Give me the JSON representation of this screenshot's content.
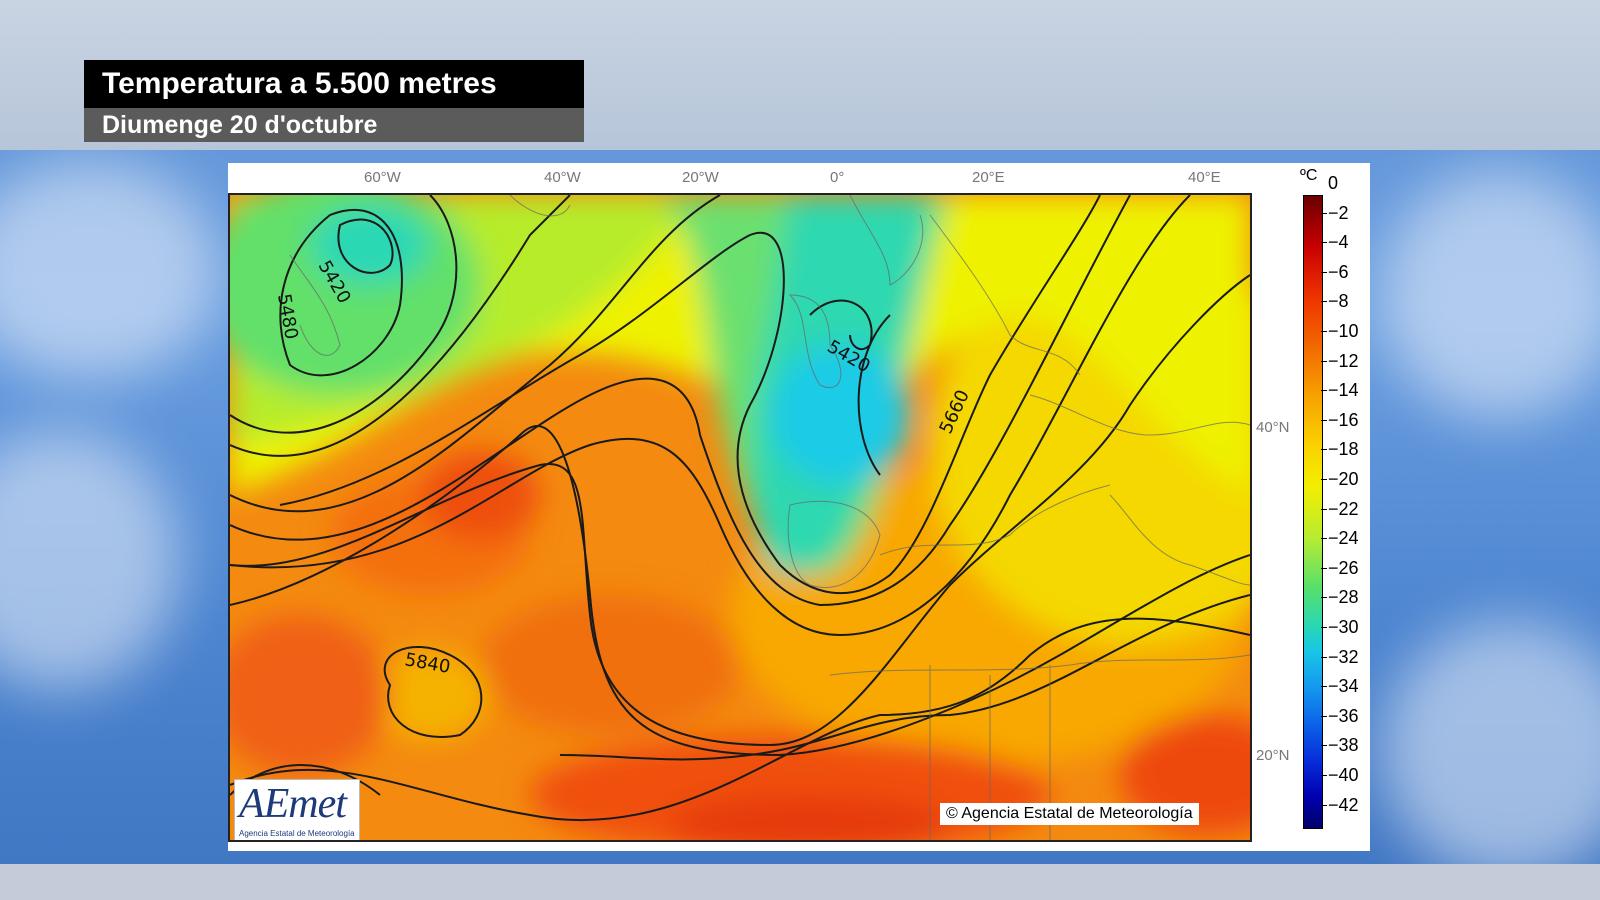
{
  "header": {
    "title": "Temperatura a 5.500 metres",
    "subtitle": "Diumenge 20 d'octubre"
  },
  "map": {
    "longitude_labels": [
      "60°W",
      "40°W",
      "20°W",
      "0°",
      "20°E",
      "40°E"
    ],
    "latitude_labels": [
      "40°N",
      "20°N"
    ],
    "contour_labels": [
      "5420",
      "5480",
      "5420",
      "5660",
      "5840"
    ],
    "copyright": "© Agencia Estatal de Meteorología",
    "logo_text": "AEmet",
    "logo_subtitle": "Agencia Estatal de Meteorología"
  },
  "colorbar": {
    "unit": "ºC",
    "labels": [
      "0",
      "−2",
      "−4",
      "−6",
      "−8",
      "−10",
      "−12",
      "−14",
      "−16",
      "−18",
      "−20",
      "−22",
      "−24",
      "−26",
      "−28",
      "−30",
      "−32",
      "−34",
      "−36",
      "−38",
      "−40",
      "−42"
    ],
    "colors": {
      "warm_end": "#6b0000",
      "mid": "#f3ee00",
      "cold_end": "#00006a"
    }
  }
}
